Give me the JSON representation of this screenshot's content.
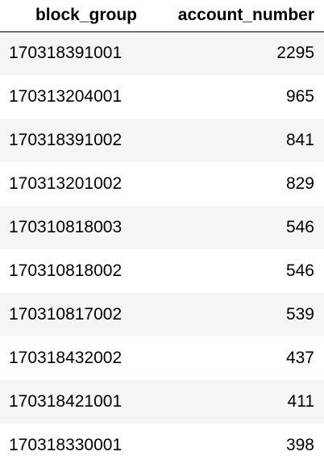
{
  "table": {
    "columns": [
      "block_group",
      "account_number"
    ],
    "rows": [
      {
        "block_group": "170318391001",
        "account_number": "2295"
      },
      {
        "block_group": "170313204001",
        "account_number": "965"
      },
      {
        "block_group": "170318391002",
        "account_number": "841"
      },
      {
        "block_group": "170313201002",
        "account_number": "829"
      },
      {
        "block_group": "170310818003",
        "account_number": "546"
      },
      {
        "block_group": "170310818002",
        "account_number": "546"
      },
      {
        "block_group": "170310817002",
        "account_number": "539"
      },
      {
        "block_group": "170318432002",
        "account_number": "437"
      },
      {
        "block_group": "170318421001",
        "account_number": "411"
      },
      {
        "block_group": "170318330001",
        "account_number": "398"
      }
    ]
  }
}
